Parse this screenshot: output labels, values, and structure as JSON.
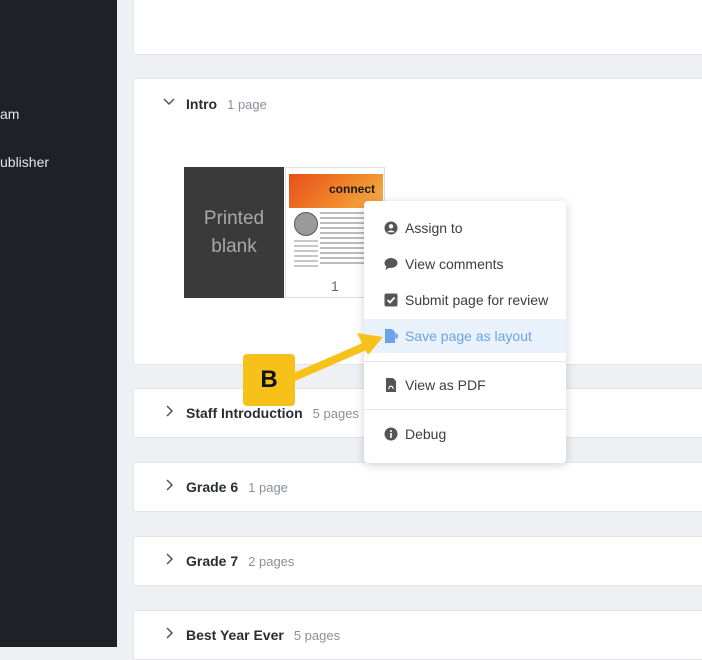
{
  "sidebar": {
    "items": [
      {
        "label": "am"
      },
      {
        "label": "ublisher"
      }
    ]
  },
  "sections": [
    {
      "title": "Intro",
      "count": "1 page",
      "expanded": true
    },
    {
      "title": "Staff Introduction",
      "count": "5 pages"
    },
    {
      "title": "Grade 6",
      "count": "1 page"
    },
    {
      "title": "Grade 7",
      "count": "2 pages"
    },
    {
      "title": "Best Year Ever",
      "count": "5 pages"
    }
  ],
  "spread": {
    "blank_line1": "Printed",
    "blank_line2": "blank",
    "thumb_title": "connect",
    "page_number": "1"
  },
  "menu": {
    "items": [
      {
        "label": "Assign to",
        "icon": "user-circle-icon"
      },
      {
        "label": "View comments",
        "icon": "comment-icon"
      },
      {
        "label": "Submit page for review",
        "icon": "checkbox-icon"
      },
      {
        "label": "Save page as layout",
        "icon": "file-export-icon",
        "active": true
      },
      {
        "label": "View as PDF",
        "icon": "pdf-file-icon"
      },
      {
        "label": "Debug",
        "icon": "info-icon"
      }
    ]
  },
  "annotation": {
    "label": "B"
  },
  "colors": {
    "accent": "#6ba3e8",
    "badge": "#f6c21a",
    "sidebar": "#1e2126"
  }
}
